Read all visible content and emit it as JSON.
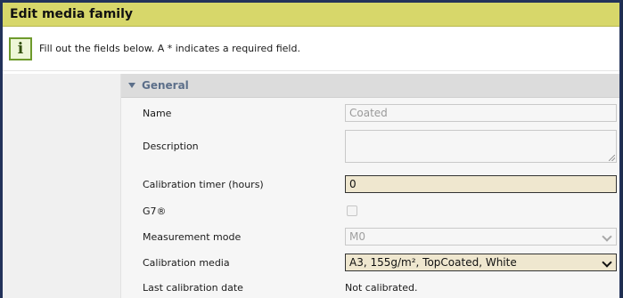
{
  "window": {
    "title": "Edit media family"
  },
  "info": {
    "icon": "info-icon",
    "icon_glyph": "i",
    "text": "Fill out the fields below. A * indicates a required field."
  },
  "section": {
    "title": "General",
    "expanded": true
  },
  "fields": {
    "name": {
      "label": "Name",
      "value": "Coated",
      "enabled": false
    },
    "description": {
      "label": "Description",
      "value": "",
      "enabled": false
    },
    "calibration_timer": {
      "label": "Calibration timer (hours)",
      "value": "0",
      "enabled": true
    },
    "g7": {
      "label": "G7®",
      "checked": false,
      "enabled": false
    },
    "measurement_mode": {
      "label": "Measurement mode",
      "value": "M0",
      "enabled": false
    },
    "calibration_media": {
      "label": "Calibration media",
      "value": "A3, 155g/m², TopCoated, White",
      "enabled": true
    },
    "last_calibration_date": {
      "label": "Last calibration date",
      "value": "Not calibrated."
    }
  }
}
